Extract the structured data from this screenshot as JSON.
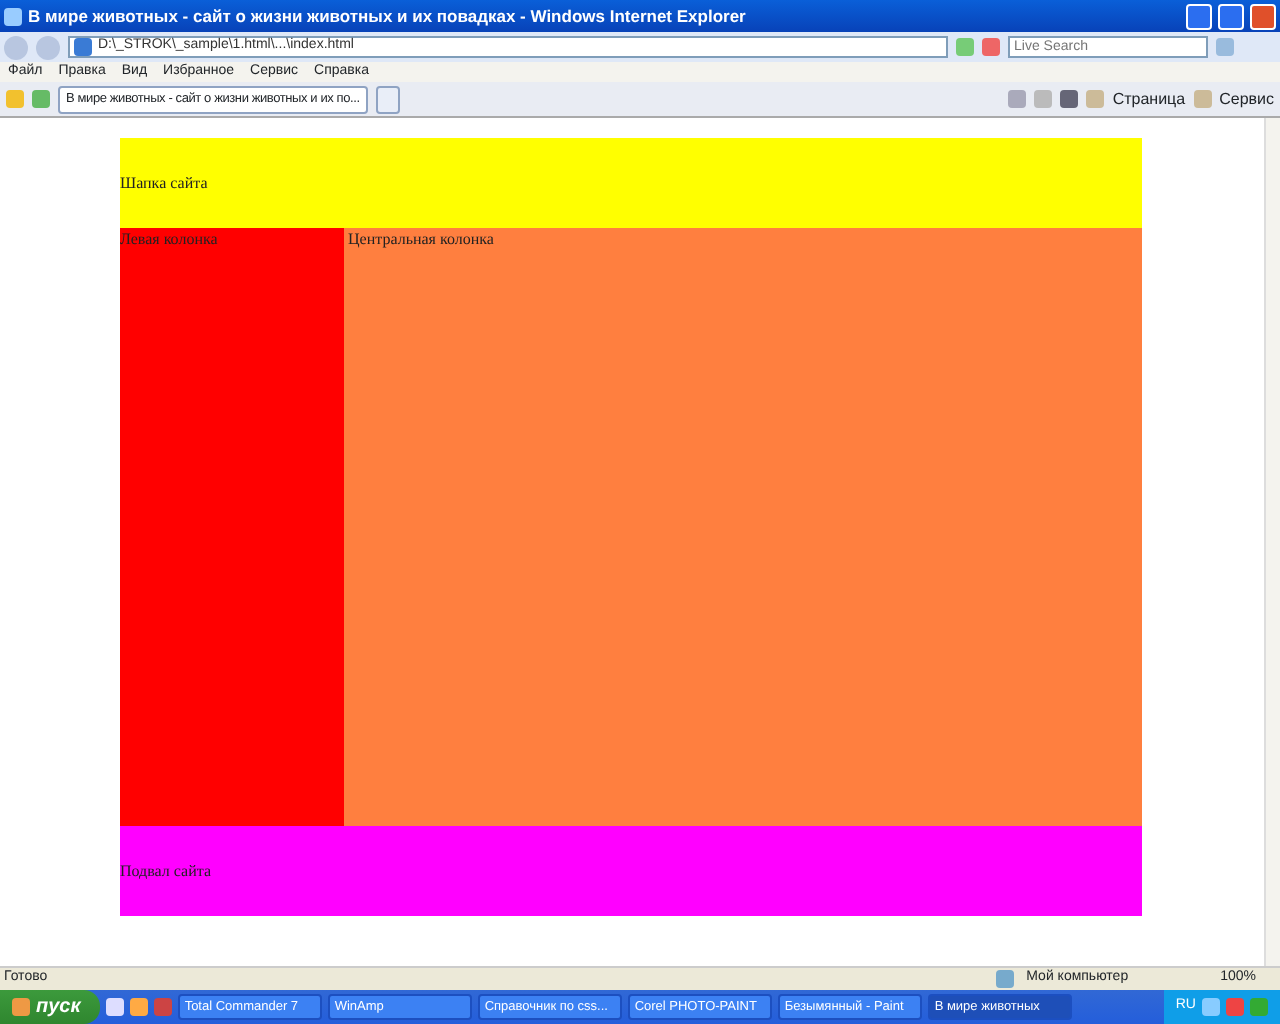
{
  "window": {
    "title": "В мире животных - сайт о жизни животных и их повадках - Windows Internet Explorer"
  },
  "address_bar": {
    "value": "D:\\_STROK\\_sample\\1.html\\...\\index.html",
    "search_placeholder": "Live Search"
  },
  "menu": [
    "Файл",
    "Правка",
    "Вид",
    "Избранное",
    "Сервис",
    "Справка"
  ],
  "tabs": [
    {
      "label": "В мире животных - сайт о жизни животных и их по...",
      "selected": true
    }
  ],
  "toolbar": [
    "Страница",
    "Сервис"
  ],
  "page": {
    "header": "Шапка сайта",
    "left_column": "Левая колонка",
    "center_column": "Центральная колонка",
    "footer": "Подвал сайта"
  },
  "status_bar": {
    "text": "Готово",
    "zone": "Мой компьютер",
    "zoom": "100%"
  },
  "taskbar": {
    "start": "пуск",
    "items": [
      {
        "label": "Total Commander 7",
        "selected": false
      },
      {
        "label": "WinAmp",
        "selected": false
      },
      {
        "label": "Справочник по css...",
        "selected": false
      },
      {
        "label": "Corel PHOTO-PAINT",
        "selected": false
      },
      {
        "label": "Безымянный - Paint",
        "selected": false
      },
      {
        "label": "В мире животных",
        "selected": true
      }
    ],
    "lang": "RU"
  }
}
